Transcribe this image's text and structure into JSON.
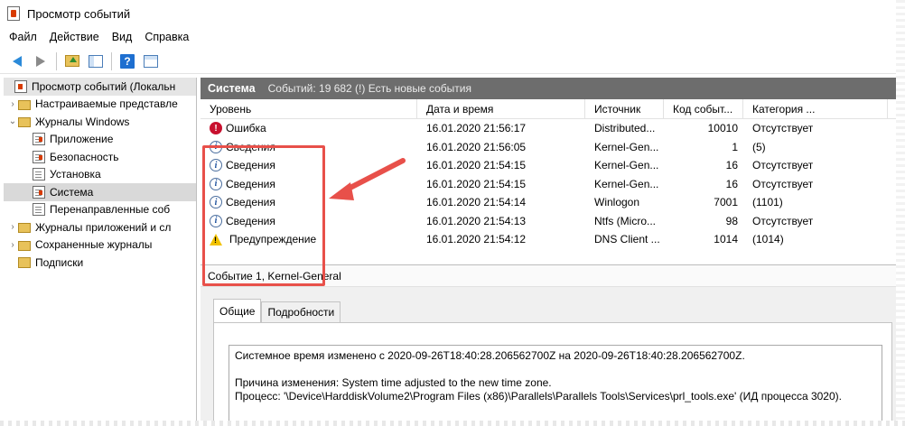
{
  "window": {
    "title": "Просмотр событий"
  },
  "menu": [
    "Файл",
    "Действие",
    "Вид",
    "Справка"
  ],
  "tree": {
    "items": [
      {
        "label": "Просмотр событий (Локальн",
        "level": 0,
        "icon": "event-viewer-icon"
      },
      {
        "label": "Настраиваемые представле",
        "level": 1,
        "icon": "folder-icon"
      },
      {
        "label": "Журналы Windows",
        "level": 1,
        "icon": "folder-icon"
      },
      {
        "label": "Приложение",
        "level": 2,
        "icon": "log-icon"
      },
      {
        "label": "Безопасность",
        "level": 2,
        "icon": "log-icon"
      },
      {
        "label": "Установка",
        "level": 2,
        "icon": "log-icon"
      },
      {
        "label": "Система",
        "level": 2,
        "icon": "log-icon"
      },
      {
        "label": "Перенаправленные соб",
        "level": 2,
        "icon": "log-icon"
      },
      {
        "label": "Журналы приложений и сл",
        "level": 1,
        "icon": "folder-icon"
      },
      {
        "label": "Сохраненные журналы",
        "level": 1,
        "icon": "folder-icon"
      },
      {
        "label": "Подписки",
        "level": 1,
        "icon": "subscriptions-icon"
      }
    ]
  },
  "log_header": {
    "title": "Система",
    "info": "Событий: 19 682 (!) Есть новые события"
  },
  "columns": [
    "Уровень",
    "Дата и время",
    "Источник",
    "Код событ...",
    "Категория ..."
  ],
  "rows": [
    {
      "level": "Ошибка",
      "type": "error",
      "date": "16.01.2020 21:56:17",
      "source": "Distributed...",
      "code": "10010",
      "category": "Отсутствует"
    },
    {
      "level": "Сведения",
      "type": "info",
      "date": "16.01.2020 21:56:05",
      "source": "Kernel-Gen...",
      "code": "1",
      "category": "(5)"
    },
    {
      "level": "Сведения",
      "type": "info",
      "date": "16.01.2020 21:54:15",
      "source": "Kernel-Gen...",
      "code": "16",
      "category": "Отсутствует"
    },
    {
      "level": "Сведения",
      "type": "info",
      "date": "16.01.2020 21:54:15",
      "source": "Kernel-Gen...",
      "code": "16",
      "category": "Отсутствует"
    },
    {
      "level": "Сведения",
      "type": "info",
      "date": "16.01.2020 21:54:14",
      "source": "Winlogon",
      "code": "7001",
      "category": "(1101)"
    },
    {
      "level": "Сведения",
      "type": "info",
      "date": "16.01.2020 21:54:13",
      "source": "Ntfs (Micro...",
      "code": "98",
      "category": "Отсутствует"
    },
    {
      "level": "Предупреждение",
      "type": "warning",
      "date": "16.01.2020 21:54:12",
      "source": "DNS Client ...",
      "code": "1014",
      "category": "(1014)"
    }
  ],
  "details": {
    "title": "Событие 1, Kernel-General",
    "tabs": [
      "Общие",
      "Подробности"
    ],
    "message": [
      "Системное время изменено с 2020-09-26T18:40:28.206562700Z на 2020-09-26T18:40:28.206562700Z.",
      "",
      "Причина изменения: System time adjusted to the new time zone.",
      "Процесс: '\\Device\\HarddiskVolume2\\Program Files (x86)\\Parallels\\Parallels Tools\\Services\\prl_tools.exe' (ИД процесса 3020)."
    ]
  },
  "colors": {
    "header_bg": "#6d6d6d",
    "callout": "#e8504a",
    "error": "#c8102e",
    "warning": "#f2c200"
  }
}
